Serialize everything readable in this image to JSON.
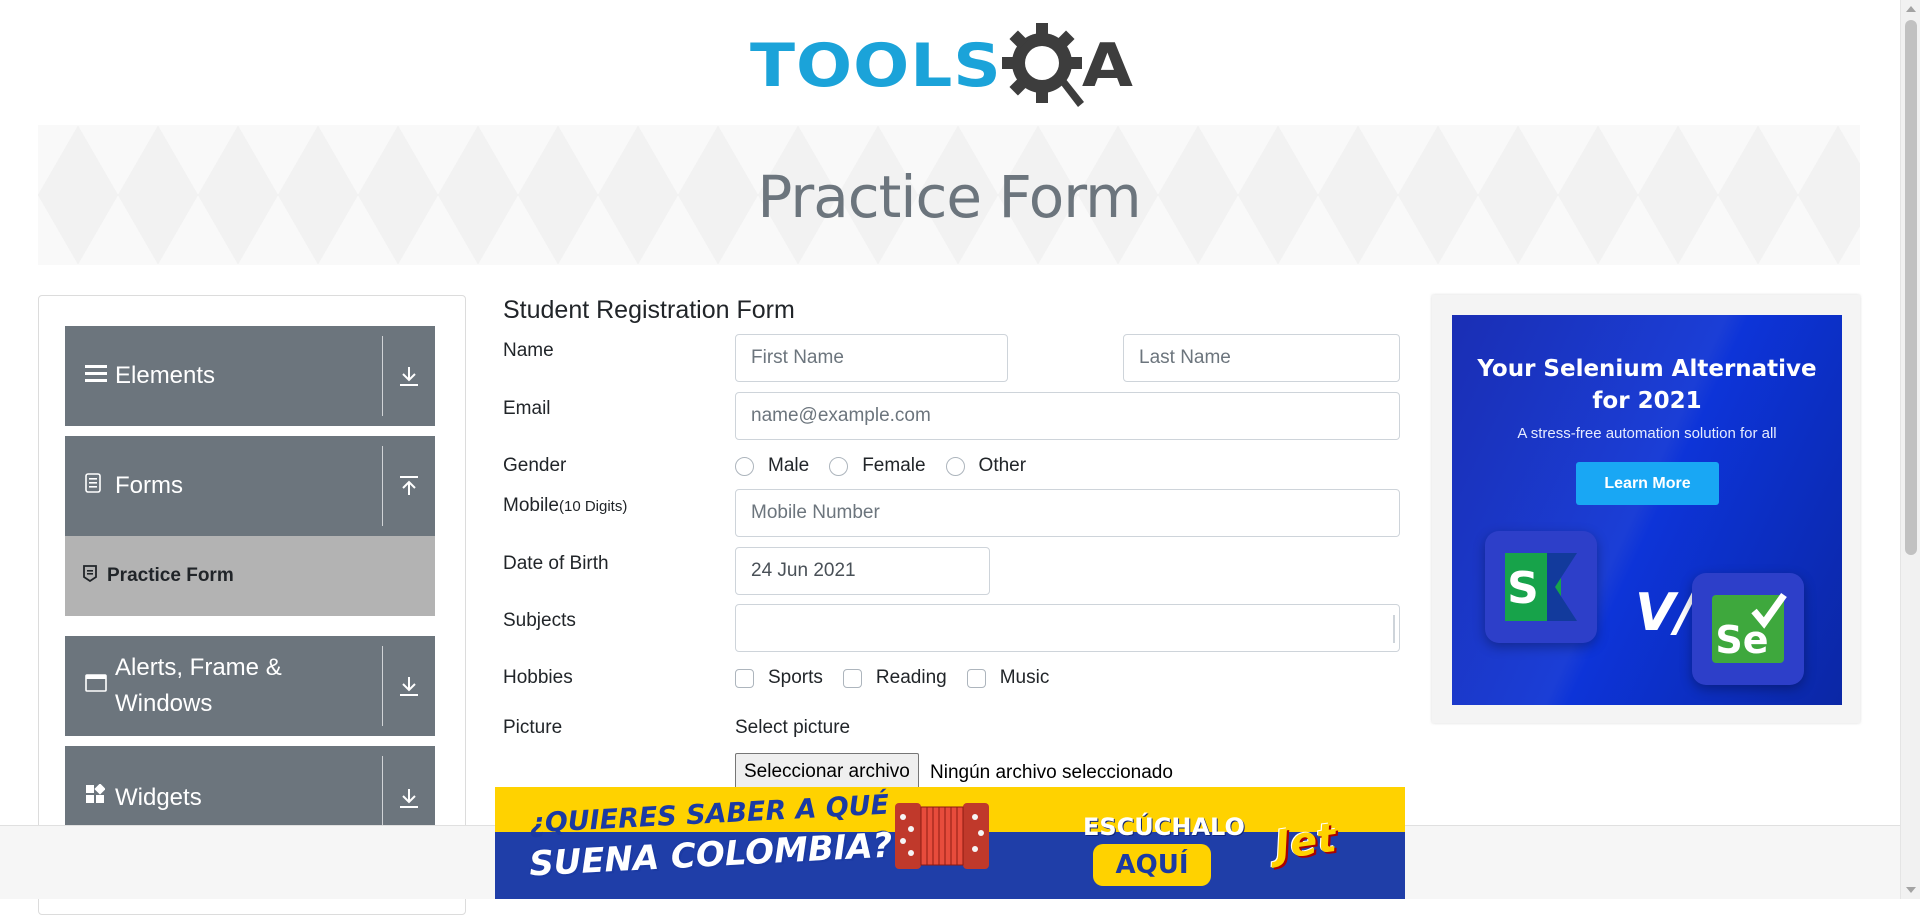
{
  "header": {
    "logo_text_blue": "TOOLS",
    "logo_text_dark": "A",
    "banner_title": "Practice Form"
  },
  "sidebar": {
    "groups": [
      {
        "label": "Elements",
        "icon": "hamburger-icon",
        "toggle_icon": "download-arrow-icon"
      },
      {
        "label": "Forms",
        "icon": "document-icon",
        "toggle_icon": "upload-arrow-icon"
      },
      {
        "label": "Alerts, Frame &",
        "label_line2": "Windows",
        "icon": "window-icon",
        "toggle_icon": "download-arrow-icon"
      },
      {
        "label": "Widgets",
        "icon": "widgets-icon",
        "toggle_icon": "download-arrow-icon"
      }
    ],
    "active_item": {
      "label": "Practice Form",
      "icon": "form-icon"
    }
  },
  "form": {
    "title": "Student Registration Form",
    "name_label": "Name",
    "first_name_placeholder": "First Name",
    "last_name_placeholder": "Last Name",
    "email_label": "Email",
    "email_placeholder": "name@example.com",
    "gender_label": "Gender",
    "gender_options": [
      "Male",
      "Female",
      "Other"
    ],
    "mobile_label": "Mobile",
    "mobile_hint": "(10 Digits)",
    "mobile_placeholder": "Mobile Number",
    "dob_label": "Date of Birth",
    "dob_value": "24 Jun 2021",
    "subjects_label": "Subjects",
    "hobbies_label": "Hobbies",
    "hobby_options": [
      "Sports",
      "Reading",
      "Music"
    ],
    "picture_label": "Picture",
    "picture_caption": "Select picture",
    "file_button": "Seleccionar archivo",
    "file_status": "Ningún archivo seleccionado"
  },
  "right_ad": {
    "headline_line1": "Your Selenium Alternative",
    "headline_line2": "for 2021",
    "subtitle": "A stress-free automation solution for all",
    "button": "Learn More",
    "vs": "V/s",
    "left_logo": "S",
    "right_logo": "Se"
  },
  "bottom_ad": {
    "line1": "¿QUIERES SABER A QUÉ",
    "line2": "SUENA COLOMBIA?",
    "cta_top": "ESCÚCHALO",
    "cta_button": "AQUÍ",
    "brand": "Jet"
  },
  "colors": {
    "sidebar_header": "#6c757d",
    "sidebar_active": "#b3b3b3",
    "logo_blue": "#1ba3d9",
    "ad_blue": "#1b3ed6",
    "ad_button": "#19a7f4",
    "bottom_ad_yellow": "#ffd200"
  }
}
